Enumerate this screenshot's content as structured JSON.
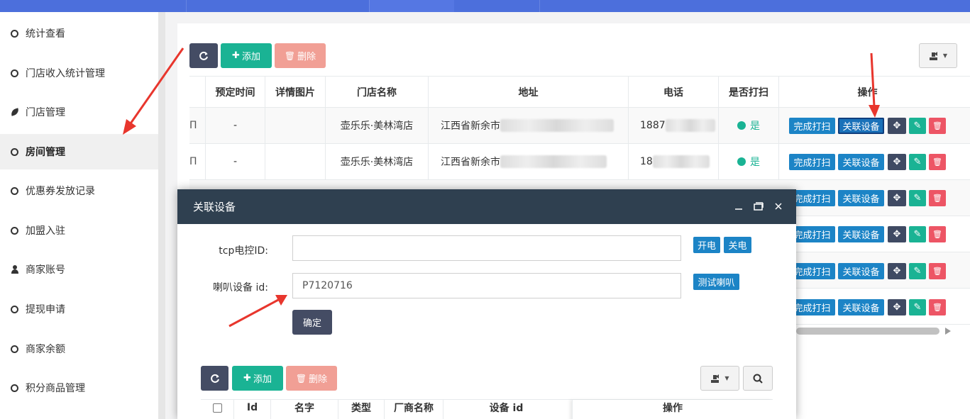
{
  "sidebar": {
    "items": [
      {
        "label": "统计查看",
        "icon": "circle-icon"
      },
      {
        "label": "门店收入统计管理",
        "icon": "circle-icon"
      },
      {
        "label": "门店管理",
        "icon": "leaf-icon"
      },
      {
        "label": "房间管理",
        "icon": "circle-icon",
        "active": true
      },
      {
        "label": "优惠券发放记录",
        "icon": "circle-icon"
      },
      {
        "label": "加盟入驻",
        "icon": "circle-icon"
      },
      {
        "label": "商家账号",
        "icon": "user-icon"
      },
      {
        "label": "提现申请",
        "icon": "circle-icon"
      },
      {
        "label": "商家余额",
        "icon": "circle-icon"
      },
      {
        "label": "积分商品管理",
        "icon": "circle-icon"
      }
    ]
  },
  "toolbar": {
    "add_label": "添加",
    "delete_label": "删除"
  },
  "table": {
    "headers": [
      "预定时间",
      "详情图片",
      "门店名称",
      "地址",
      "电话",
      "是否打扫",
      "操作"
    ],
    "rows": [
      {
        "col0": "Π",
        "reserve": "-",
        "store": "壶乐乐·美林湾店",
        "address": "江西省新余市",
        "phone": "1887",
        "clean": "是"
      },
      {
        "col0": "Π",
        "reserve": "-",
        "store": "壶乐乐·美林湾店",
        "address": "江西省新余市",
        "phone": "18",
        "clean": "是"
      }
    ],
    "actions": {
      "finish_clean": "完成打扫",
      "link_device": "关联设备"
    }
  },
  "modal": {
    "title": "关联设备",
    "tcp_label": "tcp电控ID:",
    "tcp_value": "",
    "power_on": "开电",
    "power_off": "关电",
    "speaker_label": "喇叭设备 id:",
    "speaker_value": "P7120716",
    "test_speaker": "测试喇叭",
    "confirm": "确定",
    "toolbar": {
      "add_label": "添加",
      "delete_label": "删除"
    },
    "sub_table": {
      "headers": [
        "Id",
        "名字",
        "类型",
        "厂商名称",
        "设备 id",
        "操作"
      ]
    }
  },
  "colors": {
    "topbar": "#4c6fdc",
    "accent_green": "#1ab394",
    "accent_blue": "#1c84c6",
    "danger": "#ed5565",
    "modal_header": "#2f4050",
    "annotation_arrow": "#e8362d"
  }
}
